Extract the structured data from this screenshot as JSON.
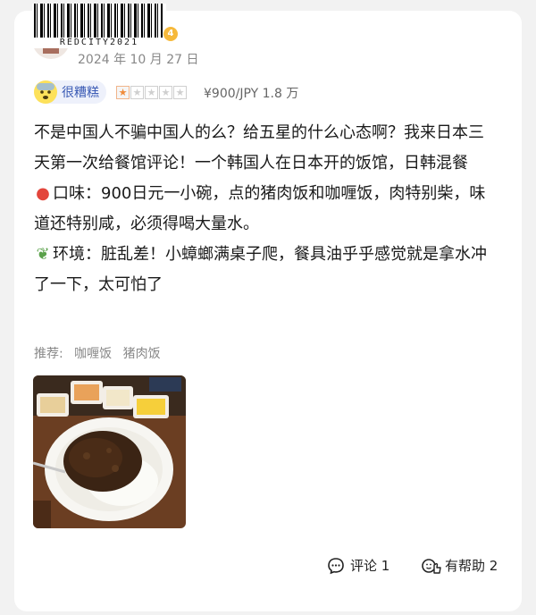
{
  "header": {
    "watermark": "REDCITY2021",
    "level": "4",
    "date": "2024 年 10 月 27 日"
  },
  "rating": {
    "mood_label": "很糟糕",
    "mood_icon": "frightened-face-icon",
    "stars_filled": 1,
    "stars_total": 5,
    "price": "¥900/JPY 1.8 万"
  },
  "review": {
    "paragraph1": "不是中国人不骗中国人的么？给五星的什么心态啊？我来日本三天第一次给餐馆评论！一个韩国人在日本开的饭馆，日韩混餐",
    "taste_icon": "rice-bowl-icon",
    "taste": "口味：900日元一小碗，点的猪肉饭和咖喱饭，肉特别柴，味道还特别咸，必须得喝大量水。",
    "env_icon": "leaf-icon",
    "environment": "环境：脏乱差！小蟑螂满桌子爬，餐具油乎乎感觉就是拿水冲了一下，太可怕了"
  },
  "recommend": {
    "label": "推荐:",
    "items": [
      "咖喱饭",
      "猪肉饭"
    ]
  },
  "photo": {
    "icon": "curry-rice-photo"
  },
  "footer": {
    "comments": "评论 1",
    "helpful": "有帮助 2"
  },
  "colors": {
    "accent_blue": "#3b5bb5",
    "star_orange": "#f08b3a",
    "muted": "#888888"
  }
}
